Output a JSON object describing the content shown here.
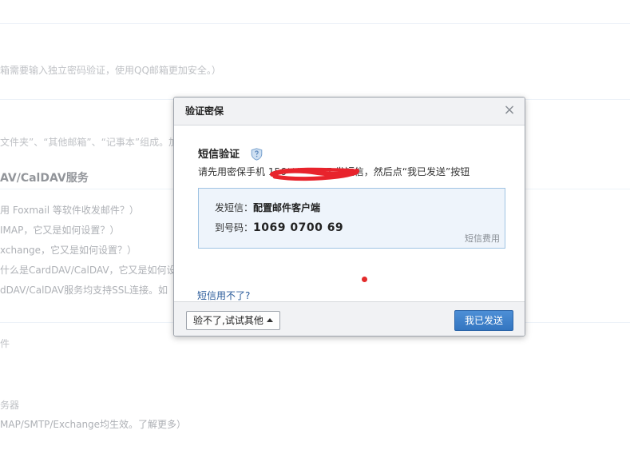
{
  "background": {
    "lines": [
      "箱需要输入独立密码验证，使用QQ邮箱更加安全。）",
      "文件夹”、“其他邮箱”、“记事本”组成。加",
      "AV/CalDAV服务",
      "用 Foxmail 等软件收发邮件？）",
      "IMAP，它又是如何设置？）",
      "xchange，它又是如何设置？）",
      "什么是CardDAV/CalDAV，它又是如何设",
      "dDAV/CalDAV服务均支持SSL连接。如",
      "件",
      "务器",
      "MAP/SMTP/Exchange均生效。了解更多）"
    ]
  },
  "dialog": {
    "title": "验证密保",
    "close_icon": "close-icon",
    "sms_title": "短信验证",
    "shield_icon": "shield-icon",
    "instruction": "请先用密保手机 156*******67 发短信，然后点“我已发送”按钮",
    "sms_box": {
      "send_label": "发短信：",
      "send_value": "配置邮件客户端",
      "to_label": "到号码：",
      "to_value": "1069 0700 69",
      "fee_link": "短信费用"
    },
    "help_link": "短信用不了?",
    "alt_button": "验不了,试试其他",
    "confirm_button": "我已发送"
  },
  "colors": {
    "accent": "#3375c0",
    "box_bg": "#eef4fb",
    "box_border": "#9fc3e3",
    "link": "#2a5b9a",
    "annotation_red": "#e32b2b"
  }
}
